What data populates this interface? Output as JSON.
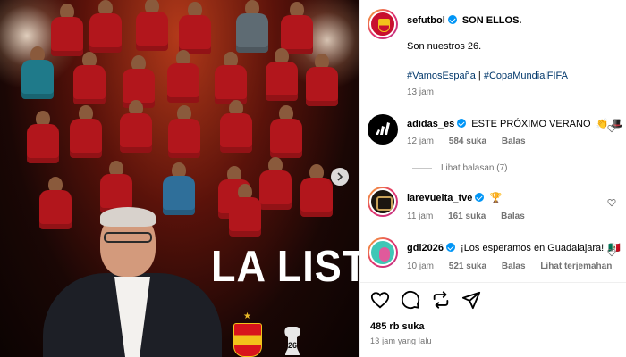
{
  "post": {
    "overlay_title": "LA LISTA",
    "author": "sefutbol",
    "caption_headline": "SON ELLOS.",
    "caption_body": "Son nuestros 26.",
    "hashtag_1": "#VamosEspaña",
    "separator": "|",
    "hashtag_2": "#CopaMundialFIFA",
    "time": "13 jam"
  },
  "comments": [
    {
      "user": "adidas_es",
      "text": "ESTE PRÓXIMO VERANO",
      "emojis": "👏 🎩 🎬",
      "time": "12 jam",
      "likes": "584 suka",
      "reply": "Balas",
      "view_replies": "Lihat balasan (7)"
    },
    {
      "user": "larevuelta_tve",
      "text": "",
      "emojis": "🏆",
      "time": "11 jam",
      "likes": "161 suka",
      "reply": "Balas"
    },
    {
      "user": "gdl2026",
      "text": "¡Los esperamos en Guadalajara!",
      "emojis": "🇲🇽",
      "time": "10 jam",
      "likes": "521 suka",
      "reply": "Balas",
      "translate": "Lihat terjemahan"
    }
  ],
  "actions": {
    "icons": [
      "heart-icon",
      "comment-icon",
      "repost-icon",
      "share-icon"
    ],
    "likes_count": "485 rb suka",
    "posted_ago": "13 jam yang lalu"
  },
  "colors": {
    "link": "#00376b",
    "verified": "#0095f6",
    "muted": "#737373",
    "spain_red": "#b2161c"
  }
}
